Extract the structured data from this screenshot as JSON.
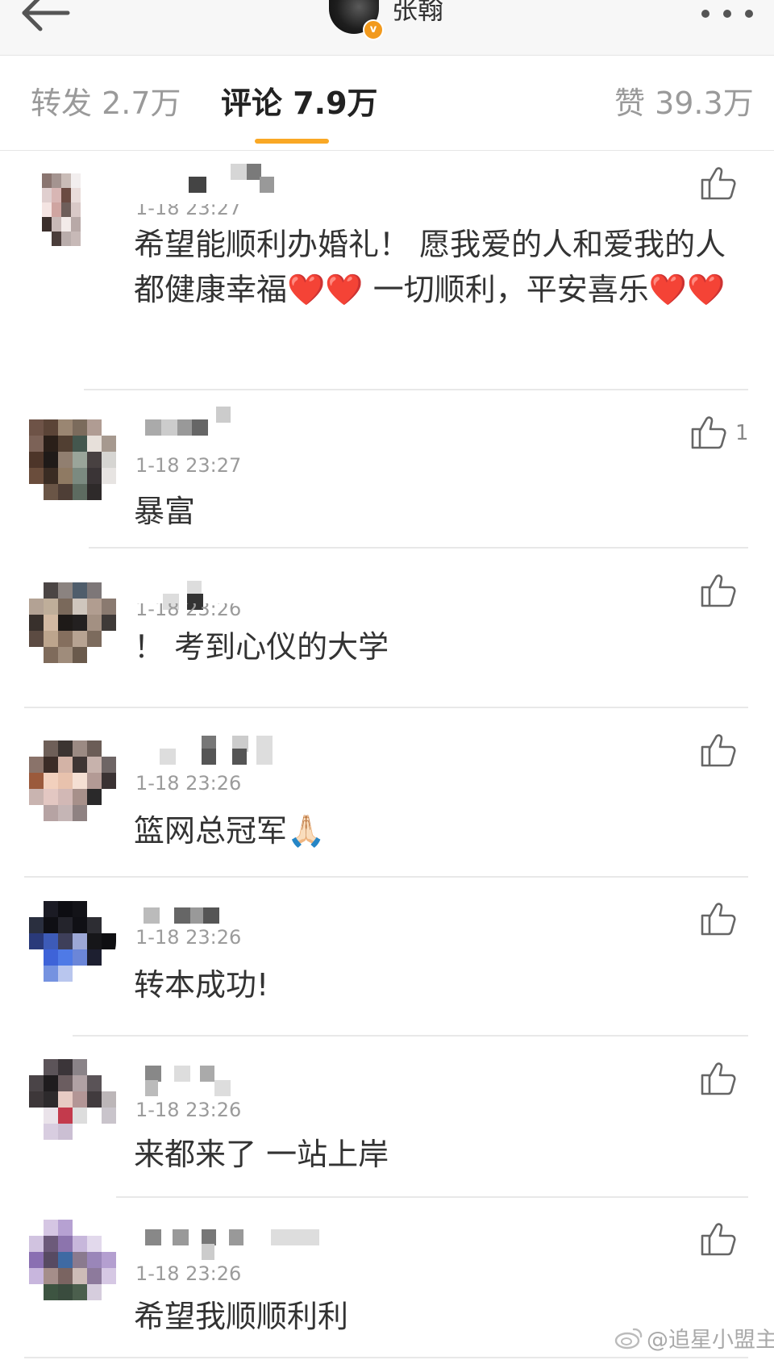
{
  "header": {
    "title": "张翰",
    "badge": "v",
    "back_icon": "arrow-left-icon",
    "more_icon": "ellipsis-icon"
  },
  "tabs": [
    {
      "label": "转发 2.7万"
    },
    {
      "label": "评论 7.9万"
    },
    {
      "label": "赞 39.3万"
    }
  ],
  "accent_color": "#f9a825",
  "comments": [
    {
      "time": "1-18 23:27",
      "text": "希望能顺利办婚礼！ 愿我爱的人和爱我的人都健康幸福❤️❤️ 一切顺利，平安喜乐❤️❤️",
      "likes": ""
    },
    {
      "time": "1-18 23:27",
      "text": "暴富",
      "likes": "1"
    },
    {
      "time": "1-18 23:26",
      "text": "！ 考到心仪的大学",
      "likes": ""
    },
    {
      "time": "1-18 23:26",
      "text": "篮网总冠军🙏🏻",
      "likes": ""
    },
    {
      "time": "1-18 23:26",
      "text": "转本成功!",
      "likes": ""
    },
    {
      "time": "1-18 23:26",
      "text": "来都来了 一站上岸",
      "likes": ""
    },
    {
      "time": "1-18 23:26",
      "text": "希望我顺顺利利",
      "likes": ""
    }
  ],
  "watermark": "@追星小盟主"
}
